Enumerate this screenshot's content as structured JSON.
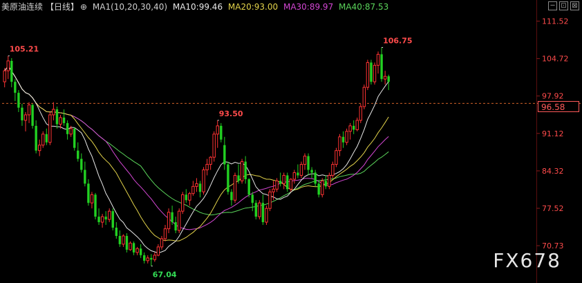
{
  "header": {
    "symbol": "美原油连续",
    "period": "【日线】",
    "ma_setting": "MA1(10,20,30,40)",
    "ma10": "MA10:99.46",
    "ma20": "MA20:93.00",
    "ma30": "MA30:89.97",
    "ma40": "MA40:87.53",
    "colors": {
      "ma10": "#e8e8e8",
      "ma20": "#e3d34a",
      "ma30": "#d447d4",
      "ma40": "#5bd65b"
    }
  },
  "toolbar": {
    "icons": [
      "minimize-icon",
      "restore-icon",
      "close-icon"
    ],
    "glyphs": [
      "─",
      "⊡",
      "⊠"
    ]
  },
  "current_price": "96.58",
  "watermark": "FX678",
  "chart_data": {
    "type": "candlestick",
    "title": "",
    "y_ticks": [
      111.52,
      104.72,
      97.92,
      91.12,
      84.32,
      77.52,
      70.73
    ],
    "ylim": [
      68.6,
      113.6
    ],
    "current_price_line": 96.58,
    "annotations": [
      {
        "text": "105.21",
        "value": 105.21,
        "candle": 1
      },
      {
        "text": "93.50",
        "value": 93.5,
        "candle": 61
      },
      {
        "text": "67.04",
        "value": 67.04,
        "candle": 42
      },
      {
        "text": "106.75",
        "value": 106.75,
        "candle": 108
      }
    ],
    "candles": [
      [
        100.5,
        103.0,
        99.5,
        102.5
      ],
      [
        102.5,
        105.21,
        101.0,
        104.3
      ],
      [
        104.3,
        104.8,
        99.5,
        100.5
      ],
      [
        100.5,
        101.0,
        97.0,
        98.5
      ],
      [
        98.5,
        99.0,
        95.0,
        95.8
      ],
      [
        95.8,
        96.5,
        92.5,
        93.5
      ],
      [
        93.5,
        95.0,
        91.5,
        94.5
      ],
      [
        94.5,
        96.8,
        93.0,
        96.3
      ],
      [
        96.3,
        96.5,
        92.0,
        92.5
      ],
      [
        92.5,
        93.5,
        87.5,
        88.0
      ],
      [
        88.0,
        90.0,
        87.0,
        89.0
      ],
      [
        89.0,
        91.5,
        88.5,
        91.0
      ],
      [
        91.0,
        92.0,
        89.0,
        89.5
      ],
      [
        89.5,
        95.0,
        89.0,
        94.5
      ],
      [
        94.5,
        96.8,
        93.5,
        95.5
      ],
      [
        95.5,
        96.0,
        92.0,
        92.8
      ],
      [
        92.8,
        94.5,
        92.0,
        94.0
      ],
      [
        94.0,
        95.5,
        92.5,
        93.0
      ],
      [
        93.0,
        93.5,
        90.0,
        91.0
      ],
      [
        91.0,
        92.5,
        90.5,
        92.0
      ],
      [
        92.0,
        92.2,
        88.0,
        88.5
      ],
      [
        88.0,
        89.5,
        86.0,
        86.5
      ],
      [
        86.5,
        87.5,
        84.0,
        84.5
      ],
      [
        84.5,
        86.0,
        81.5,
        82.0
      ],
      [
        82.0,
        82.8,
        78.0,
        78.5
      ],
      [
        78.5,
        80.5,
        77.5,
        80.0
      ],
      [
        80.0,
        80.3,
        75.5,
        76.0
      ],
      [
        76.0,
        77.5,
        74.5,
        75.0
      ],
      [
        75.0,
        76.5,
        74.0,
        76.0
      ],
      [
        76.0,
        77.0,
        74.5,
        75.5
      ],
      [
        75.5,
        77.5,
        75.0,
        77.0
      ],
      [
        77.0,
        77.5,
        73.5,
        74.0
      ],
      [
        74.0,
        75.0,
        72.0,
        72.5
      ],
      [
        72.5,
        73.5,
        70.5,
        71.0
      ],
      [
        71.0,
        72.8,
        70.5,
        72.5
      ],
      [
        72.5,
        73.0,
        69.5,
        70.0
      ],
      [
        70.0,
        71.5,
        69.8,
        71.2
      ],
      [
        71.2,
        71.5,
        69.0,
        69.5
      ],
      [
        69.5,
        70.5,
        69.0,
        70.2
      ],
      [
        70.2,
        71.0,
        68.5,
        69.0
      ],
      [
        69.0,
        69.5,
        67.5,
        68.0
      ],
      [
        68.0,
        69.0,
        67.5,
        68.5
      ],
      [
        68.5,
        69.2,
        67.04,
        68.2
      ],
      [
        68.2,
        69.5,
        67.8,
        69.0
      ],
      [
        69.0,
        71.0,
        68.8,
        70.5
      ],
      [
        70.5,
        72.5,
        70.0,
        72.0
      ],
      [
        72.0,
        74.5,
        71.5,
        73.8
      ],
      [
        73.8,
        77.5,
        73.0,
        76.8
      ],
      [
        76.8,
        78.0,
        74.5,
        75.0
      ],
      [
        75.0,
        76.0,
        73.0,
        73.5
      ],
      [
        73.5,
        77.5,
        73.0,
        77.0
      ],
      [
        77.0,
        80.5,
        76.5,
        80.0
      ],
      [
        80.0,
        81.0,
        78.5,
        79.0
      ],
      [
        79.0,
        80.5,
        78.0,
        80.2
      ],
      [
        80.2,
        82.5,
        79.8,
        81.5
      ],
      [
        81.5,
        83.0,
        80.5,
        82.0
      ],
      [
        82.0,
        82.5,
        79.5,
        80.5
      ],
      [
        80.5,
        85.0,
        80.0,
        84.5
      ],
      [
        84.5,
        86.5,
        83.5,
        85.5
      ],
      [
        85.5,
        87.0,
        84.5,
        86.8
      ],
      [
        86.8,
        91.5,
        86.0,
        91.0
      ],
      [
        91.0,
        93.5,
        88.5,
        92.5
      ],
      [
        92.5,
        93.0,
        89.5,
        90.0
      ],
      [
        89.0,
        90.5,
        84.5,
        85.5
      ],
      [
        85.5,
        86.0,
        80.0,
        80.5
      ],
      [
        80.5,
        81.0,
        78.0,
        79.0
      ],
      [
        79.0,
        84.0,
        78.5,
        83.5
      ],
      [
        83.5,
        85.5,
        82.0,
        82.5
      ],
      [
        82.5,
        86.5,
        82.0,
        86.0
      ],
      [
        86.0,
        87.0,
        82.0,
        82.8
      ],
      [
        82.8,
        83.0,
        79.5,
        80.0
      ],
      [
        80.0,
        80.5,
        77.0,
        78.5
      ],
      [
        78.5,
        79.0,
        75.5,
        76.0
      ],
      [
        76.0,
        79.0,
        75.5,
        78.5
      ],
      [
        78.5,
        80.0,
        74.5,
        75.0
      ],
      [
        75.0,
        78.0,
        74.5,
        77.5
      ],
      [
        77.5,
        81.0,
        77.0,
        80.5
      ],
      [
        80.5,
        82.5,
        79.0,
        81.0
      ],
      [
        81.0,
        83.0,
        80.5,
        82.5
      ],
      [
        82.5,
        84.0,
        81.5,
        82.0
      ],
      [
        82.0,
        84.0,
        81.0,
        83.5
      ],
      [
        83.5,
        84.0,
        80.5,
        81.0
      ],
      [
        81.0,
        83.0,
        80.5,
        82.8
      ],
      [
        82.8,
        84.5,
        82.0,
        84.0
      ],
      [
        84.0,
        85.5,
        83.0,
        83.5
      ],
      [
        83.5,
        86.0,
        83.0,
        85.5
      ],
      [
        85.5,
        87.5,
        84.5,
        87.0
      ],
      [
        87.0,
        87.5,
        83.5,
        84.5
      ],
      [
        84.5,
        85.0,
        83.0,
        84.0
      ],
      [
        84.0,
        84.5,
        81.5,
        82.0
      ],
      [
        82.0,
        82.5,
        79.5,
        80.0
      ],
      [
        80.0,
        83.0,
        79.5,
        82.5
      ],
      [
        82.5,
        83.5,
        81.0,
        81.5
      ],
      [
        81.5,
        84.0,
        81.0,
        83.5
      ],
      [
        83.5,
        86.0,
        83.0,
        85.5
      ],
      [
        85.5,
        88.5,
        85.0,
        88.0
      ],
      [
        88.0,
        91.0,
        87.0,
        90.5
      ],
      [
        90.5,
        91.5,
        88.5,
        89.5
      ],
      [
        89.5,
        92.0,
        89.0,
        91.5
      ],
      [
        91.5,
        93.0,
        90.0,
        92.5
      ],
      [
        92.5,
        93.5,
        91.0,
        91.8
      ],
      [
        91.8,
        94.0,
        91.5,
        93.5
      ],
      [
        93.5,
        96.5,
        93.0,
        96.0
      ],
      [
        96.0,
        100.0,
        95.5,
        99.5
      ],
      [
        99.5,
        104.5,
        99.0,
        104.0
      ],
      [
        104.0,
        104.5,
        100.0,
        100.5
      ],
      [
        100.5,
        104.0,
        100.0,
        103.5
      ],
      [
        103.5,
        106.0,
        102.0,
        105.5
      ],
      [
        105.5,
        106.75,
        100.5,
        101.0
      ],
      [
        101.0,
        102.5,
        100.0,
        101.5
      ],
      [
        101.5,
        101.8,
        99.0,
        100.5
      ]
    ]
  }
}
